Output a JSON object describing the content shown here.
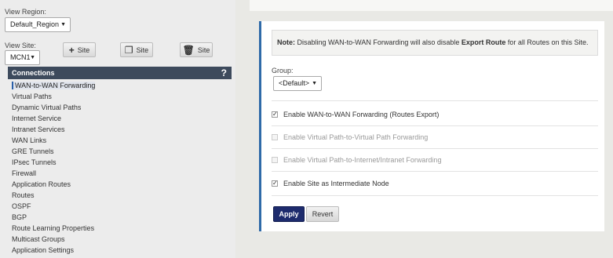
{
  "sidebar": {
    "view_region_label": "View Region:",
    "region_value": "Default_Region",
    "view_site_label": "View Site:",
    "site_value": "MCN1",
    "add_site_label": "Site",
    "copy_site_label": "Site",
    "delete_site_label": "Site",
    "connections_title": "Connections",
    "help_label": "?",
    "items": [
      {
        "label": "WAN-to-WAN Forwarding"
      },
      {
        "label": "Virtual Paths"
      },
      {
        "label": "Dynamic Virtual Paths"
      },
      {
        "label": "Internet Service"
      },
      {
        "label": "Intranet Services"
      },
      {
        "label": "WAN Links"
      },
      {
        "label": "GRE Tunnels"
      },
      {
        "label": "IPsec Tunnels"
      },
      {
        "label": "Firewall"
      },
      {
        "label": "Application Routes"
      },
      {
        "label": "Routes"
      },
      {
        "label": "OSPF"
      },
      {
        "label": "BGP"
      },
      {
        "label": "Route Learning Properties"
      },
      {
        "label": "Multicast Groups"
      },
      {
        "label": "Application Settings"
      }
    ]
  },
  "content": {
    "note_label": "Note:",
    "note_text_1": " Disabling WAN-to-WAN Forwarding will also disable ",
    "note_bold": "Export Route",
    "note_text_2": " for all Routes on this Site.",
    "group_label": "Group:",
    "group_value": "<Default>",
    "options": [
      {
        "label": "Enable WAN-to-WAN Forwarding (Routes Export)",
        "checked": true,
        "disabled": false
      },
      {
        "label": "Enable Virtual Path-to-Virtual Path Forwarding",
        "checked": false,
        "disabled": true
      },
      {
        "label": "Enable Virtual Path-to-Internet/Intranet Forwarding",
        "checked": false,
        "disabled": true
      },
      {
        "label": "Enable Site as Intermediate Node",
        "checked": true,
        "disabled": false
      }
    ],
    "apply_label": "Apply",
    "revert_label": "Revert"
  },
  "colors": {
    "accent": "#2f6aa8",
    "header_bg": "#3d4a5c",
    "apply_bg": "#1d2b6d"
  }
}
